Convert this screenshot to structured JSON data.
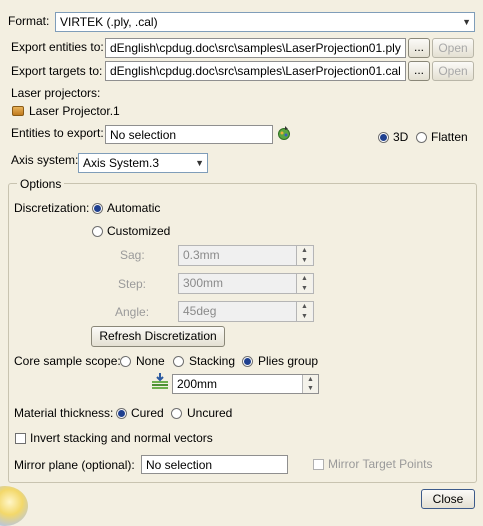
{
  "format": {
    "label": "Format:",
    "value": "VIRTEK (.ply, .cal)"
  },
  "export_entities": {
    "label": "Export entities to:",
    "path": "dEnglish\\cpdug.doc\\src\\samples\\LaserProjection01.ply",
    "browse": "...",
    "open": "Open"
  },
  "export_targets": {
    "label": "Export targets to:",
    "path": "dEnglish\\cpdug.doc\\src\\samples\\LaserProjection01.cal",
    "browse": "...",
    "open": "Open"
  },
  "laser_projectors": {
    "label": "Laser projectors:",
    "item": "Laser Projector.1"
  },
  "entities_to_export": {
    "label": "Entities to export:",
    "value": "No selection"
  },
  "view_mode": {
    "opt_3d": "3D",
    "opt_flatten": "Flatten",
    "selected": "3D"
  },
  "axis_system": {
    "label": "Axis system:",
    "value": "Axis System.3"
  },
  "options": {
    "title": "Options",
    "discretization_label": "Discretization:",
    "automatic": "Automatic",
    "customized": "Customized",
    "discretization_selected": "Automatic",
    "sag_label": "Sag:",
    "sag_value": "0.3mm",
    "step_label": "Step:",
    "step_value": "300mm",
    "angle_label": "Angle:",
    "angle_value": "45deg",
    "refresh_button": "Refresh Discretization",
    "core_label": "Core sample scope:",
    "core_none": "None",
    "core_stacking": "Stacking",
    "core_plies": "Plies group",
    "core_selected": "Plies group",
    "core_value": "200mm",
    "thickness_label": "Material thickness:",
    "thickness_cured": "Cured",
    "thickness_uncured": "Uncured",
    "thickness_selected": "Cured",
    "invert_label": "Invert stacking and normal vectors",
    "mirror_label": "Mirror plane (optional):",
    "mirror_value": "No selection",
    "mirror_targets_label": "Mirror Target Points"
  },
  "close_button": "Close",
  "colors": {
    "dialog_bg": "#f3efe1",
    "radio_dot": "#1e3f8f",
    "disabled_text": "#9a9a9a"
  }
}
